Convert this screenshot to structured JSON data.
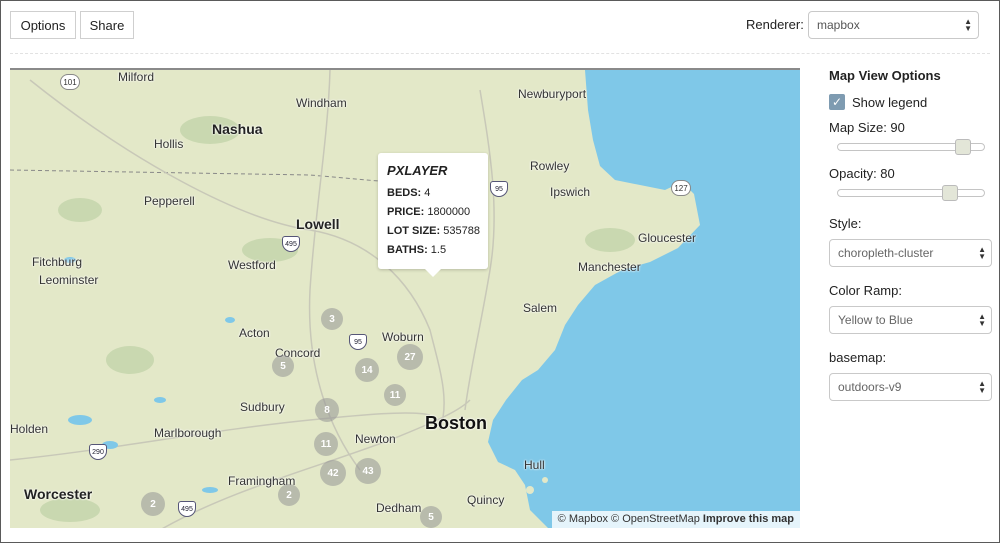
{
  "toolbar": {
    "options_label": "Options",
    "share_label": "Share",
    "renderer_label": "Renderer:",
    "renderer_value": "mapbox"
  },
  "map": {
    "places": {
      "milford": "Milford",
      "windham": "Windham",
      "newburyport": "Newburyport",
      "nashua": "Nashua",
      "hollis": "Hollis",
      "rowley": "Rowley",
      "ipswich": "Ipswich",
      "pepperell": "Pepperell",
      "lowell": "Lowell",
      "gloucester": "Gloucester",
      "fitchburg": "Fitchburg",
      "westford": "Westford",
      "manchester": "Manchester",
      "leominster": "Leominster",
      "salem": "Salem",
      "acton": "Acton",
      "woburn": "Woburn",
      "concord": "Concord",
      "sudbury": "Sudbury",
      "boston": "Boston",
      "holden": "Holden",
      "marlborough": "Marlborough",
      "newton": "Newton",
      "framingham": "Framingham",
      "hull": "Hull",
      "worcester": "Worcester",
      "quincy": "Quincy",
      "dedham": "Dedham"
    },
    "shields": {
      "r101": "101",
      "r95": "95",
      "r127": "127",
      "r495a": "495",
      "r95b": "95",
      "r290": "290",
      "r495b": "495"
    },
    "clusters": {
      "c1": "3",
      "c2": "27",
      "c3": "5",
      "c4": "14",
      "c5": "11",
      "c6": "8",
      "c7": "11",
      "c8": "42",
      "c9": "43",
      "c10": "2",
      "c11": "2",
      "c12": "5"
    },
    "popup": {
      "title": "PXLAYER",
      "beds_label": "BEDS:",
      "beds_value": "4",
      "price_label": "PRICE:",
      "price_value": "1800000",
      "lot_label": "LOT SIZE:",
      "lot_value": "535788",
      "baths_label": "BATHS:",
      "baths_value": "1.5"
    },
    "attribution": {
      "mapbox": "© Mapbox",
      "osm": "© OpenStreetMap",
      "improve": "Improve this map"
    },
    "colors": {
      "ocean": "#7fc8e8",
      "land": "#e3e8c8"
    }
  },
  "panel": {
    "title": "Map View Options",
    "show_legend_label": "Show legend",
    "show_legend_checked": true,
    "map_size_label": "Map Size: 90",
    "map_size_value": 90,
    "opacity_label": "Opacity: 80",
    "opacity_value": 80,
    "style_label": "Style:",
    "style_value": "choropleth-cluster",
    "color_ramp_label": "Color Ramp:",
    "color_ramp_value": "Yellow to Blue",
    "basemap_label": "basemap:",
    "basemap_value": "outdoors-v9"
  }
}
